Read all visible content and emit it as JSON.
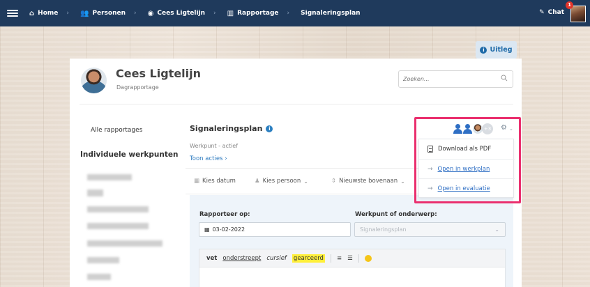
{
  "topbar": {
    "breadcrumbs": [
      {
        "label": "Home",
        "icon": "home-icon"
      },
      {
        "label": "Personen",
        "icon": "people-icon"
      },
      {
        "label": "Cees Ligtelijn",
        "icon": "user-avatar-icon"
      },
      {
        "label": "Rapportage",
        "icon": "bar-chart-icon"
      },
      {
        "label": "Signaleringsplan"
      }
    ],
    "separator": "›",
    "chat_label": "Chat",
    "notification_count": "1"
  },
  "help": {
    "label": "Uitleg",
    "icon_glyph": "i"
  },
  "profile": {
    "name": "Cees Ligtelijn",
    "subtitle": "Dagrapportage"
  },
  "search": {
    "placeholder": "Zoeken..."
  },
  "sidebar": {
    "all_reports": "Alle rapportages",
    "individual_heading": "Individuele werkpunten"
  },
  "section": {
    "title": "Signaleringsplan",
    "status": "Werkpunt - actief",
    "toggle_actions": "Toon acties",
    "toggle_chevron": "›"
  },
  "filters": {
    "date": "Kies datum",
    "person": "Kies persoon",
    "sort": "Nieuwste bovenaan",
    "chevron": "⌄"
  },
  "participants": {
    "more_count": "+3"
  },
  "menu": {
    "items": [
      {
        "label": "Download als PDF",
        "icon": "pdf-icon"
      },
      {
        "label": "Open in werkplan",
        "icon": "arrow-right-icon"
      },
      {
        "label": "Open in evaluatie",
        "icon": "arrow-right-icon"
      }
    ]
  },
  "form": {
    "report_on_label": "Rapporteer op:",
    "report_on_value": "03-02-2022",
    "topic_label": "Werkpunt of onderwerp:",
    "topic_value": "Signaleringsplan"
  },
  "editor": {
    "bold": "vet",
    "underline": "onderstreept",
    "italic": "cursief",
    "highlight": "gearceerd"
  },
  "colors": {
    "topbar": "#1f3a5c",
    "link": "#2f6fc4",
    "highlight_frame": "#ea2f6e",
    "panel": "#eef4fa"
  }
}
